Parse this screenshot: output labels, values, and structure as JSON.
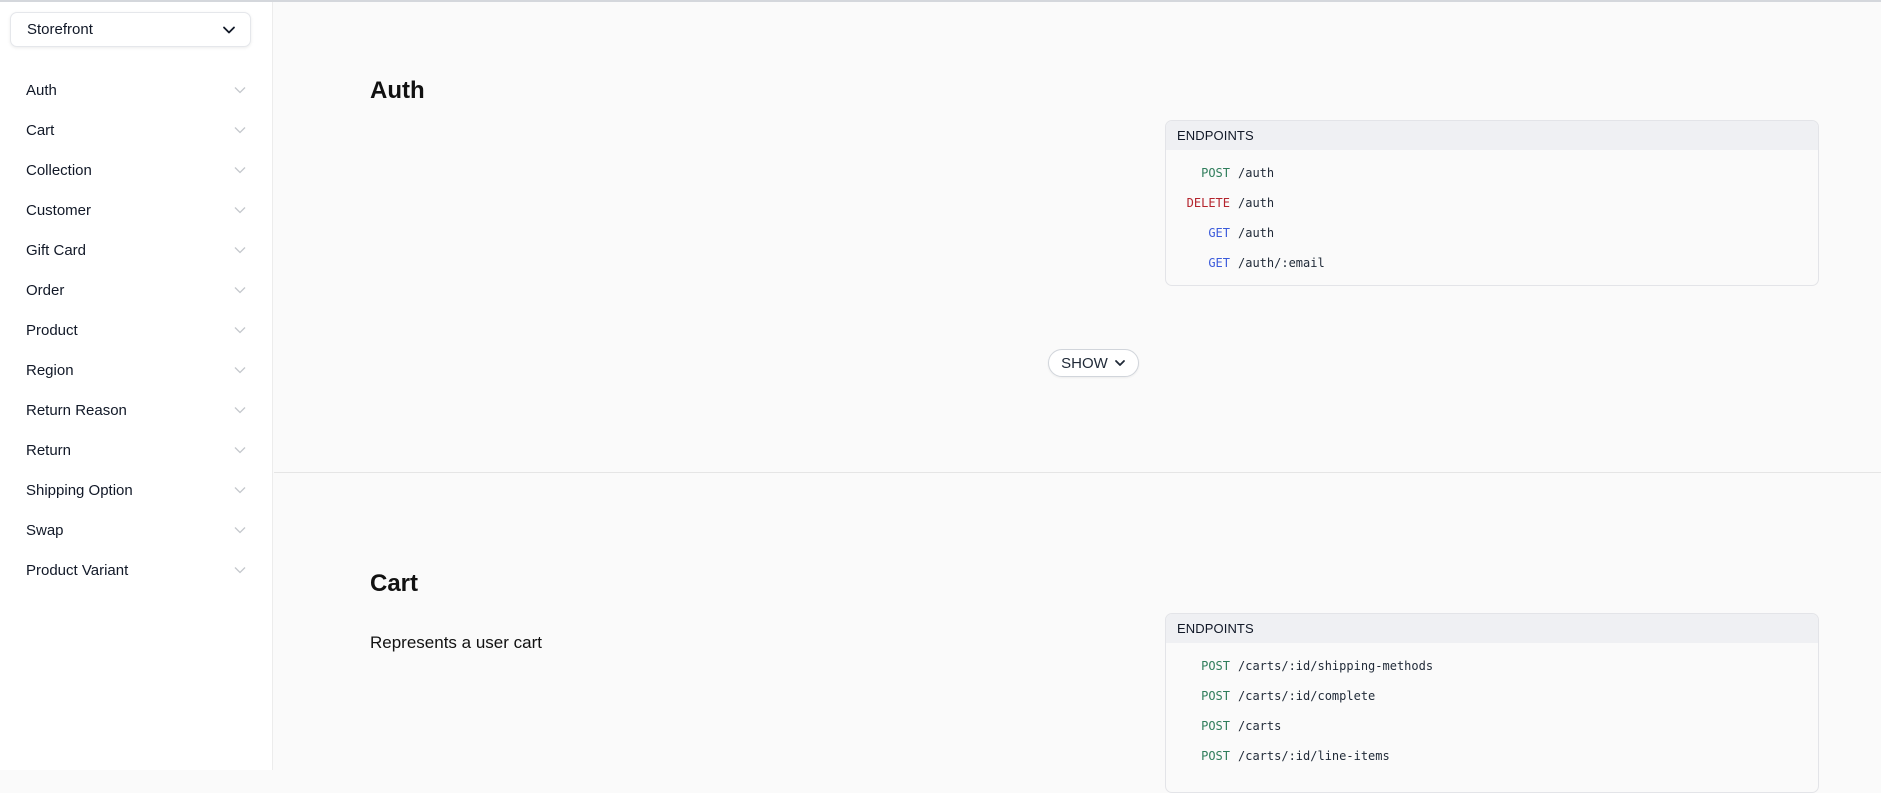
{
  "sidebar": {
    "api_selector": {
      "value": "Storefront"
    },
    "items": [
      {
        "label": "Auth"
      },
      {
        "label": "Cart"
      },
      {
        "label": "Collection"
      },
      {
        "label": "Customer"
      },
      {
        "label": "Gift Card"
      },
      {
        "label": "Order"
      },
      {
        "label": "Product"
      },
      {
        "label": "Region"
      },
      {
        "label": "Return Reason"
      },
      {
        "label": "Return"
      },
      {
        "label": "Shipping Option"
      },
      {
        "label": "Swap"
      },
      {
        "label": "Product Variant"
      }
    ]
  },
  "sections": {
    "auth": {
      "title": "Auth",
      "endpoints_label": "ENDPOINTS",
      "endpoints": [
        {
          "method": "POST",
          "path": "/auth"
        },
        {
          "method": "DELETE",
          "path": "/auth"
        },
        {
          "method": "GET",
          "path": "/auth"
        },
        {
          "method": "GET",
          "path": "/auth/:email"
        }
      ],
      "show_label": "SHOW"
    },
    "cart": {
      "title": "Cart",
      "description": "Represents a user cart",
      "endpoints_label": "ENDPOINTS",
      "endpoints": [
        {
          "method": "POST",
          "path": "/carts/:id/shipping-methods"
        },
        {
          "method": "POST",
          "path": "/carts/:id/complete"
        },
        {
          "method": "POST",
          "path": "/carts"
        },
        {
          "method": "POST",
          "path": "/carts/:id/line-items"
        }
      ]
    }
  },
  "colors": {
    "post": "#2f7d5b",
    "delete": "#b4232c",
    "get": "#3b5bdb"
  }
}
